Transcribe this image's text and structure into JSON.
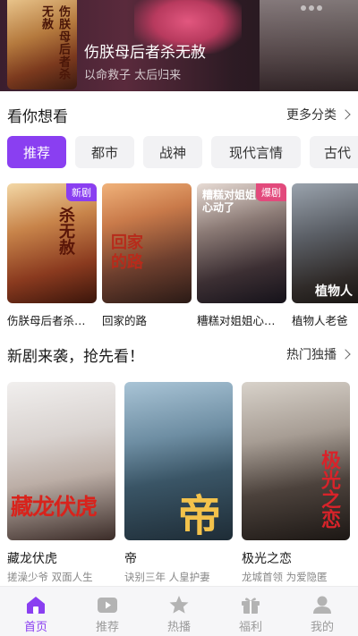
{
  "hero": {
    "title": "伤朕母后者杀无赦",
    "subtitle": "以命救子 太后归来",
    "poster_title": "伤朕母后者杀无赦"
  },
  "section1": {
    "title": "看你想看",
    "more_label": "更多分类"
  },
  "tabs": [
    {
      "label": "推荐",
      "active": true
    },
    {
      "label": "都市",
      "active": false
    },
    {
      "label": "战神",
      "active": false
    },
    {
      "label": "现代言情",
      "active": false
    },
    {
      "label": "古代",
      "active": false
    }
  ],
  "row1": [
    {
      "name": "伤朕母后者杀…",
      "badge": "新剧",
      "poster_text": "杀无赦"
    },
    {
      "name": "回家的路",
      "badge": "",
      "poster_text": "回家的路"
    },
    {
      "name": "糟糕对姐姐心…",
      "badge": "爆剧",
      "poster_text": "糟糕对姐姐心动了"
    },
    {
      "name": "植物人老爸",
      "badge": "",
      "poster_text": "植物人"
    }
  ],
  "section2": {
    "title": "新剧来袭，抢先看！",
    "more_label": "热门独播"
  },
  "row2": [
    {
      "name": "藏龙伏虎",
      "desc": "搓澡少爷 双面人生",
      "poster_text": "藏龙伏虎"
    },
    {
      "name": "帝",
      "desc": "诀别三年 人皇护妻",
      "poster_text": "帝"
    },
    {
      "name": "极光之恋",
      "desc": "龙城首领 为爱隐匿",
      "poster_text": "极光之恋"
    }
  ],
  "nav": [
    {
      "label": "首页",
      "icon": "home-icon",
      "active": true
    },
    {
      "label": "推荐",
      "icon": "play-icon",
      "active": false
    },
    {
      "label": "热播",
      "icon": "star-icon",
      "active": false
    },
    {
      "label": "福利",
      "icon": "gift-icon",
      "active": false
    },
    {
      "label": "我的",
      "icon": "user-icon",
      "active": false
    }
  ],
  "colors": {
    "accent": "#8a3ff1",
    "hot_badge": "#e24a7c",
    "nav_inactive": "#9a9a9a"
  }
}
